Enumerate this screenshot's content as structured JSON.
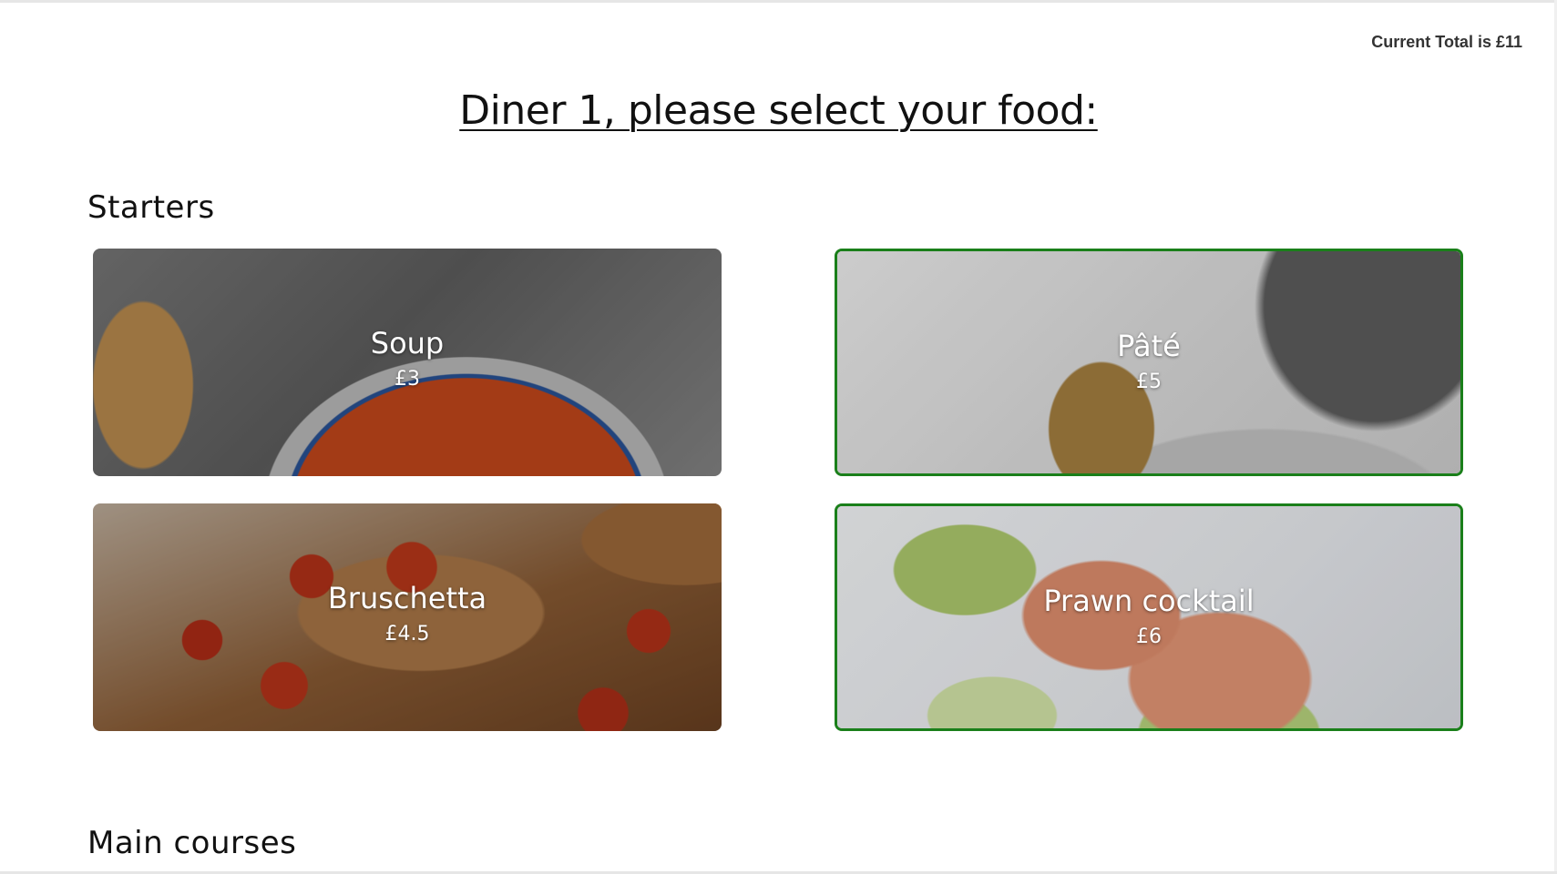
{
  "header": {
    "total_text": "Current Total is £11"
  },
  "page": {
    "title": "Diner 1, please select your food:"
  },
  "sections": [
    {
      "title": "Starters",
      "items": [
        {
          "name": "Soup",
          "price": "£3",
          "selected": false
        },
        {
          "name": "Pâté",
          "price": "£5",
          "selected": true
        },
        {
          "name": "Bruschetta",
          "price": "£4.5",
          "selected": false
        },
        {
          "name": "Prawn cocktail",
          "price": "£6",
          "selected": true
        }
      ]
    },
    {
      "title": "Main courses",
      "items": []
    }
  ],
  "colors": {
    "selected_border": "#1a7f1a",
    "text_dark": "#111111"
  }
}
